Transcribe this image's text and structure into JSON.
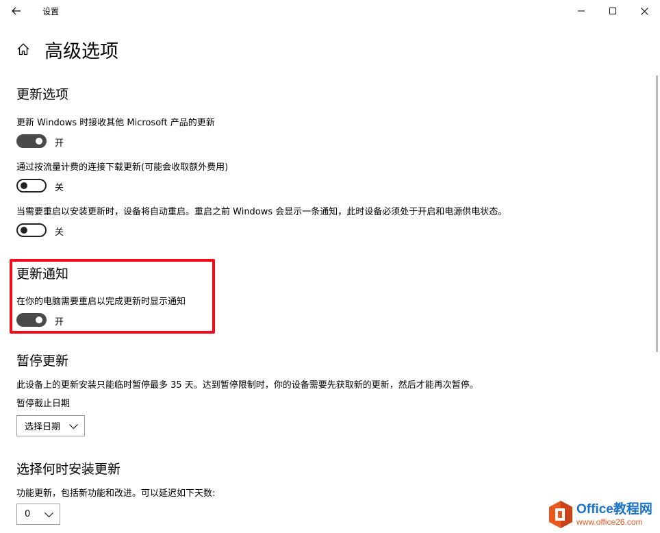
{
  "window": {
    "title": "设置"
  },
  "page": {
    "title": "高级选项"
  },
  "update_options": {
    "heading": "更新选项",
    "items": [
      {
        "desc": "更新 Windows 时接收其他 Microsoft 产品的更新",
        "state": "开"
      },
      {
        "desc": "通过按流量计费的连接下载更新(可能会收取额外费用)",
        "state": "关"
      },
      {
        "desc": "当需要重启以安装更新时，设备将自动重启。重启之前 Windows 会显示一条通知，此时设备必须处于开启和电源供电状态。",
        "state": "关"
      }
    ]
  },
  "update_notifications": {
    "heading": "更新通知",
    "desc": "在你的电脑需要重启以完成更新时显示通知",
    "state": "开"
  },
  "pause_updates": {
    "heading": "暂停更新",
    "desc": "此设备上的更新安装只能临时暂停最多 35 天。达到暂停限制时，你的设备需要先获取新的更新，然后才能再次暂停。",
    "date_label": "暂停截止日期",
    "date_select": "选择日期"
  },
  "install_timing": {
    "heading": "选择何时安装更新",
    "desc": "功能更新，包括新功能和改进。可以延迟如下天数:",
    "days_select": "0"
  },
  "watermark": {
    "brand": "Office教程网",
    "url": "www.office26.com"
  },
  "colors": {
    "highlight": "#f20c1a",
    "toggle_on": "#4a4a4a",
    "brand_blue": "#1a73c8",
    "brand_orange": "#e8591f"
  }
}
